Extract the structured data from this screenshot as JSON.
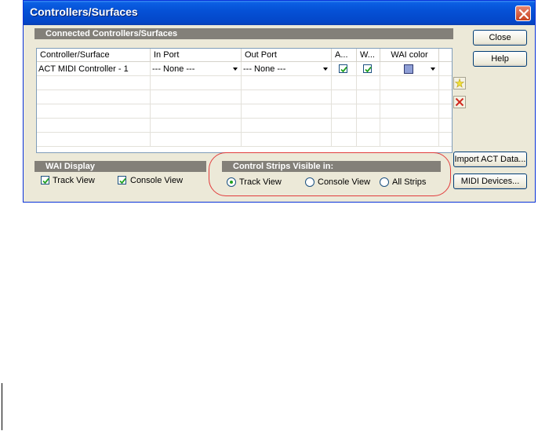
{
  "window": {
    "title": "Controllers/Surfaces"
  },
  "connected": {
    "header": "Connected Controllers/Surfaces",
    "columns": [
      "Controller/Surface",
      "In Port",
      "Out Port",
      "A...",
      "W...",
      "WAI color"
    ],
    "rows": [
      {
        "controller": "ACT MIDI Controller - 1",
        "in_port": "--- None ---",
        "out_port": "--- None ---",
        "a_checked": true,
        "w_checked": true,
        "wai_color": "#8f9fd6"
      }
    ]
  },
  "buttons": {
    "close": "Close",
    "help": "Help",
    "import": "Import ACT Data...",
    "midi_devices": "MIDI Devices..."
  },
  "icons": {
    "add": "add-star-icon",
    "remove": "delete-x-icon"
  },
  "wai_display": {
    "header": "WAI Display",
    "track_view_label": "Track View",
    "track_view_checked": true,
    "console_view_label": "Console View",
    "console_view_checked": true
  },
  "strips": {
    "header": "Control Strips Visible in:",
    "options": [
      "Track View",
      "Console View",
      "All Strips"
    ],
    "selected": "Track View"
  },
  "colors": {
    "title_bar": "#0551d6",
    "highlight_ring": "#e23c3c",
    "group_header": "#838079"
  }
}
